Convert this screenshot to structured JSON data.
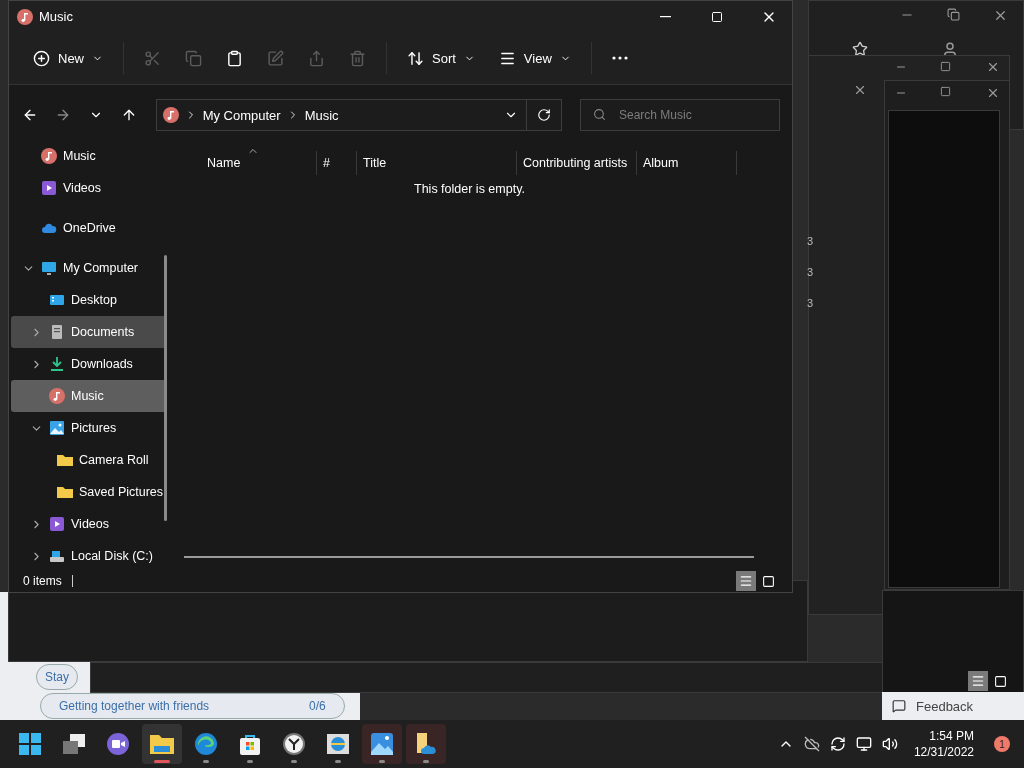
{
  "window": {
    "title": "Music"
  },
  "command_bar": {
    "new_label": "New",
    "tools": [
      {
        "disabled": true
      },
      {
        "disabled": true
      },
      {
        "disabled": false
      },
      {
        "disabled": true
      },
      {
        "disabled": true
      },
      {
        "disabled": true
      }
    ],
    "sort_label": "Sort",
    "view_label": "View"
  },
  "navigation": {
    "back_disabled": false,
    "forward_disabled": true
  },
  "address": {
    "path": [
      "My Computer",
      "Music"
    ]
  },
  "search": {
    "placeholder": "Search Music"
  },
  "sidebar": {
    "sections": [
      {
        "items": [
          {
            "label": "Music",
            "kind": "music",
            "selected": false,
            "hovered": false
          },
          {
            "label": "Videos",
            "kind": "videos",
            "selected": false,
            "hovered": false
          }
        ]
      },
      {
        "items": [
          {
            "label": "OneDrive",
            "kind": "cloud",
            "selected": false,
            "hovered": false
          }
        ]
      },
      {
        "items": [
          {
            "label": "My Computer",
            "kind": "computer",
            "selected": false,
            "hovered": false,
            "expanded": true,
            "children": [
              {
                "label": "Desktop",
                "kind": "desktop",
                "selected": false,
                "hovered": false
              },
              {
                "label": "Documents",
                "kind": "documents",
                "selected": false,
                "hovered": true,
                "expanded": false
              },
              {
                "label": "Downloads",
                "kind": "downloads",
                "selected": false,
                "hovered": false,
                "expanded": false
              },
              {
                "label": "Music",
                "kind": "music",
                "selected": true,
                "hovered": false
              },
              {
                "label": "Pictures",
                "kind": "pictures",
                "selected": false,
                "hovered": false,
                "expanded": true,
                "children": [
                  {
                    "label": "Camera Roll",
                    "kind": "folder",
                    "selected": false,
                    "hovered": false
                  },
                  {
                    "label": "Saved Pictures",
                    "kind": "folder",
                    "selected": false,
                    "hovered": false
                  }
                ]
              },
              {
                "label": "Videos",
                "kind": "videos",
                "selected": false,
                "hovered": false,
                "expanded": false
              },
              {
                "label": "Local Disk (C:)",
                "kind": "disk",
                "selected": false,
                "hovered": false,
                "expanded": false
              }
            ]
          }
        ]
      }
    ]
  },
  "columns": [
    {
      "label": "Name",
      "sorted": true
    },
    {
      "label": "#",
      "sorted": false
    },
    {
      "label": "Title",
      "sorted": false
    },
    {
      "label": "Contributing artists",
      "sorted": false
    },
    {
      "label": "Album",
      "sorted": false
    }
  ],
  "empty_message": "This folder is empty.",
  "status_bar": {
    "count": "0 items",
    "views": [
      {
        "kind": "details",
        "selected": true
      },
      {
        "kind": "tiles",
        "selected": false
      }
    ]
  },
  "background": {
    "digits": [
      "3",
      "3",
      "3"
    ],
    "pills": [
      {
        "label": "Stay"
      },
      {
        "label": "Getting together with friends",
        "count": "0/6"
      }
    ],
    "feedback": "Feedback",
    "views": [
      {
        "kind": "details",
        "selected": true
      },
      {
        "kind": "tiles",
        "selected": false
      }
    ]
  },
  "taskbar": {
    "apps": [
      {
        "kind": "start",
        "running": false,
        "active": false,
        "flagged": false
      },
      {
        "kind": "taskview",
        "running": false,
        "active": false,
        "flagged": false
      },
      {
        "kind": "chat",
        "running": false,
        "active": false,
        "flagged": false
      },
      {
        "kind": "explorer",
        "running": true,
        "active": true,
        "flagged": false
      },
      {
        "kind": "edge",
        "running": true,
        "active": false,
        "flagged": false
      },
      {
        "kind": "store",
        "running": true,
        "active": false,
        "flagged": false
      },
      {
        "kind": "clock",
        "running": true,
        "active": false,
        "flagged": false
      },
      {
        "kind": "ie",
        "running": true,
        "active": false,
        "flagged": false
      },
      {
        "kind": "photos",
        "running": true,
        "active": false,
        "flagged": true
      },
      {
        "kind": "onedrive-folder",
        "running": true,
        "active": false,
        "flagged": true
      }
    ],
    "time": "1:54 PM",
    "date": "12/31/2022",
    "notifications": "1"
  }
}
